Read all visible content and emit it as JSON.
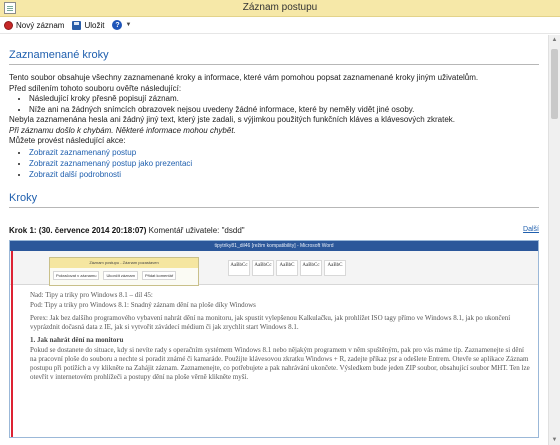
{
  "window": {
    "title": "Záznam postupu"
  },
  "toolbar": {
    "new_record_label": "Nový záznam",
    "save_label": "Uložit",
    "help_symbol": "?"
  },
  "recorded_steps": {
    "heading": "Zaznamenané kroky",
    "intro": "Tento soubor obsahuje všechny zaznamenané kroky a informace, které vám pomohou popsat zaznamenané kroky jiným uživatelům.",
    "before_sharing": "Před sdílením tohoto souboru ověřte následující:",
    "checks": [
      "Následující kroky přesně popisují záznam.",
      "Níže ani na žádných snímcích obrazovek nejsou uvedeny žádné informace, které by neměly vidět jiné osoby."
    ],
    "no_passwords": "Nebyla zaznamenána hesla ani žádný jiný text, který jste zadali, s výjimkou použitých funkčních kláves a klávesových zkratek.",
    "errors_note": "Při záznamu došlo k chybám. Některé informace mohou chybět.",
    "actions_intro": "Můžete provést následující akce:",
    "links": [
      "Zobrazit zaznamenaný postup",
      "Zobrazit zaznamenaný postup jako prezentaci",
      "Zobrazit další podrobnosti"
    ]
  },
  "steps": {
    "heading": "Kroky",
    "next_label": "Další",
    "step1_label": "Krok 1: (30. července 2014 20:18:07)",
    "step1_comment": "Komentář uživatele: \"dsdd\""
  },
  "screenshot": {
    "word_title": "tipytriky81_dil46 [režim kompatibility] - Microsoft Word",
    "dialog_title": "Záznam postupu - Záznam pozastaven",
    "dialog_buttons": [
      "Pokračovat v záznamu",
      "Ukončit záznam",
      "Přidat komentář"
    ],
    "style_boxes": [
      "AaBbCc",
      "AaBbCc",
      "AaBbC",
      "AaBbCc",
      "AaBbC"
    ],
    "doc_lines": [
      "Nad: Tipy a triky pro Windows 8.1 – díl 45:",
      "Pod: Tipy a triky pro Windows 8.1: Snadný záznam dění na ploše díky Windows",
      "Perex: Jak bez dalšího programového vybavení nahrát dění na monitoru, jak spustit vylepšenou Kalkulačku, jak prohlížet ISO tagy přímo ve Windows 8.1, jak po ukončení vyprázdnit dočasná data z IE, jak si vytvořit závádecí médium či jak zrychlit start Windows 8.1.",
      "1. Jak nahrát dění na monitoru",
      "Pokud se dostanete do situace, kdy si nevíte rady s operačním systémem Windows 8.1 nebo nějakým programem v něm spuštěným, pak pro vás máme tip. Zaznamenejte si dění na pracovní ploše do souboru a nechte si poradit známé či kamaráde. Použijte klávesovou zkratku Windows + R, zadejte příkaz psr a odešlete Entrem. Otevře se aplikace Záznam postupu při potížích a vy klikněte na Zahájit záznam. Zaznamenejte, co potřebujete a pak nahrávání ukončete. Výsledkem bude jeden ZIP soubor, obsahující soubor MHT. Ten lze otevřít v internetovém prohlížeči a postupy dění na ploše věrně klikněte myší."
    ]
  }
}
